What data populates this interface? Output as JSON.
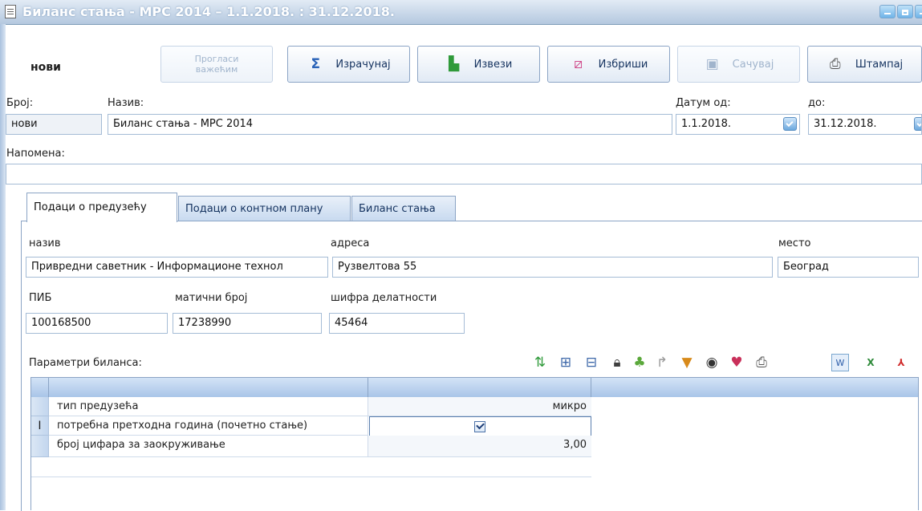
{
  "window": {
    "title": "Биланс стања - MPC 2014 – 1.1.2018. : 31.12.2018."
  },
  "toolbar": {
    "mode": "нови",
    "buttons": [
      {
        "label": "Прогласи важећим",
        "icon": "declare-valid-icon",
        "enabled": false
      },
      {
        "label": "Израчунај",
        "icon": "sum-icon",
        "enabled": true
      },
      {
        "label": "Извези",
        "icon": "export-icon",
        "enabled": true
      },
      {
        "label": "Избриши",
        "icon": "eraser-icon",
        "enabled": true
      },
      {
        "label": "Сачувај",
        "icon": "save-icon",
        "enabled": false
      },
      {
        "label": "Штампај",
        "icon": "printer-icon",
        "enabled": true
      }
    ]
  },
  "header": {
    "broj_label": "Број:",
    "broj_value": "нови",
    "naziv_label": "Назив:",
    "naziv_value": "Биланс стања - MPC 2014",
    "datum_od_label": "Датум од:",
    "datum_od_value": "1.1.2018.",
    "do_label": "до:",
    "do_value": "31.12.2018.",
    "napomena_label": "Напомена:",
    "napomena_value": ""
  },
  "tabs": [
    "Подаци о предузећу",
    "Подаци о контном плану",
    "Биланс стања"
  ],
  "company": {
    "naziv_label": "назив",
    "naziv_value": "Привредни саветник - Информационе технол",
    "adresa_label": "адреса",
    "adresa_value": "Рузвелтова 55",
    "mesto_label": "место",
    "mesto_value": "Београд",
    "pib_label": "ПИБ",
    "pib_value": "100168500",
    "mb_label": "матични број",
    "mb_value": "17238990",
    "sifra_label": "шифра делатности",
    "sifra_value": "45464"
  },
  "params": {
    "label": "Параметри биланса:",
    "rows": [
      {
        "name": "тип предузећа",
        "value": "микро",
        "indicator": ""
      },
      {
        "name": "потребна претходна година (почетно стање)",
        "value": "",
        "checked": true,
        "indicator": "I"
      },
      {
        "name": "број цифара за заокруживање",
        "value": "3,00",
        "indicator": ""
      }
    ]
  },
  "colors": {
    "accent": "#14325f",
    "border": "#8ba4c5",
    "header": "#a9c5e8"
  }
}
